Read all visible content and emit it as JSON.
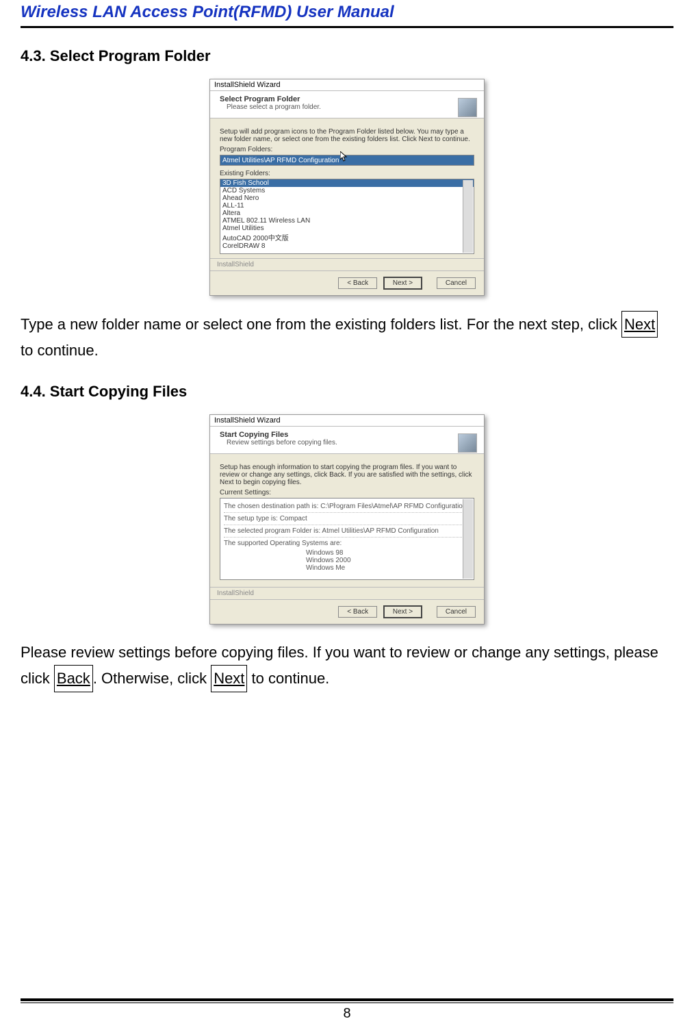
{
  "header": {
    "title": "Wireless LAN Access Point(RFMD) User Manual"
  },
  "section1": {
    "heading": "4.3.  Select Program Folder",
    "text_before": "Type a new folder name or select one from the existing folders list. For the next step, click ",
    "next": "Next",
    "text_after": " to continue."
  },
  "section2": {
    "heading": "4.4.  Start Copying Files",
    "text_a": "Please review settings before copying files. If you want to review or change any settings, please click ",
    "back": "Back",
    "text_b": ". Otherwise, click ",
    "next": "Next",
    "text_c": " to continue."
  },
  "wiz1": {
    "titlebar": "InstallShield Wizard",
    "title": "Select Program Folder",
    "sub": "Please select a program folder.",
    "desc": "Setup will add program icons to the Program Folder listed below.  You may type a new folder name, or select one from the existing folders list.  Click Next to continue.",
    "label_pf": "Program Folders:",
    "pf_value": "Atmel Utilities\\AP RFMD Configuration",
    "label_ef": "Existing Folders:",
    "folders": [
      "3D Fish School",
      "ACD Systems",
      "Ahead Nero",
      "ALL-11",
      "Altera",
      "ATMEL 802.11 Wireless LAN",
      "Atmel Utilities",
      "AutoCAD 2000中文版",
      "CorelDRAW 8"
    ],
    "brand": "InstallShield",
    "btn_back": "< Back",
    "btn_next": "Next >",
    "btn_cancel": "Cancel"
  },
  "wiz2": {
    "titlebar": "InstallShield Wizard",
    "title": "Start Copying Files",
    "sub": "Review settings before copying files.",
    "desc": "Setup has enough information to start copying the program files. If you want to review or change any settings, click Back. If you are satisfied with the settings, click Next to begin copying files.",
    "label_cs": "Current Settings:",
    "line1": "The chosen destination path is: C:\\Program Files\\Atmel\\AP RFMD Configuration",
    "line2": "The setup type is: Compact",
    "line3": "The selected program Folder is: Atmel Utilities\\AP RFMD Configuration",
    "line4": "The supported Operating Systems are:",
    "os1": "Windows 98",
    "os2": "Windows 2000",
    "os3": "Windows Me",
    "brand": "InstallShield",
    "btn_back": "< Back",
    "btn_next": "Next >",
    "btn_cancel": "Cancel"
  },
  "footer": {
    "page": "8"
  }
}
